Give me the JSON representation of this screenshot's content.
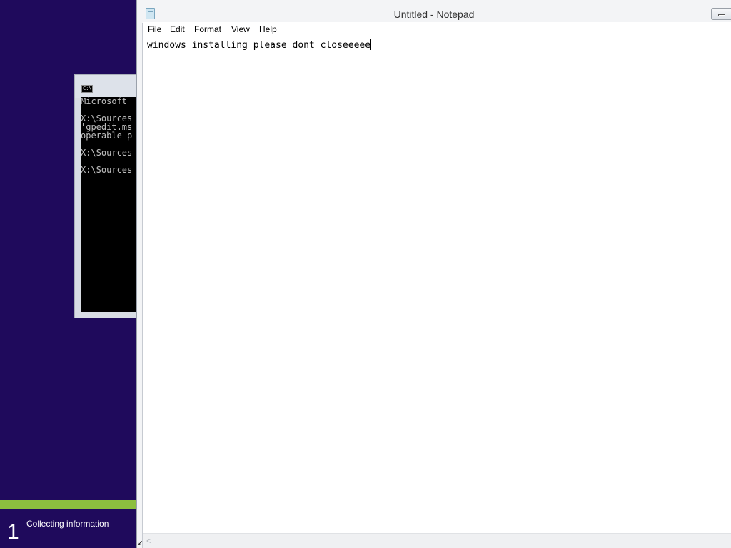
{
  "setup": {
    "progress_fraction": 1.0,
    "step_number": "1",
    "step_label": "Collecting information"
  },
  "cmd": {
    "icon_text": "C:\\",
    "lines": [
      "Microsoft",
      "",
      "X:\\Sources",
      "'gpedit.ms",
      "operable p",
      "",
      "X:\\Sources",
      "",
      "X:\\Sources"
    ]
  },
  "notepad": {
    "title": "Untitled - Notepad",
    "menu": [
      "File",
      "Edit",
      "Format",
      "View",
      "Help"
    ],
    "content": "windows installing please dont closeeeee",
    "scroll_left_glyph": "<",
    "resize_glyph": "↙"
  },
  "colors": {
    "desktop_bg": "#1f0a5c",
    "progress_fill": "#8cbf3f",
    "console_bg": "#000000",
    "console_text": "#c0c0c0"
  }
}
